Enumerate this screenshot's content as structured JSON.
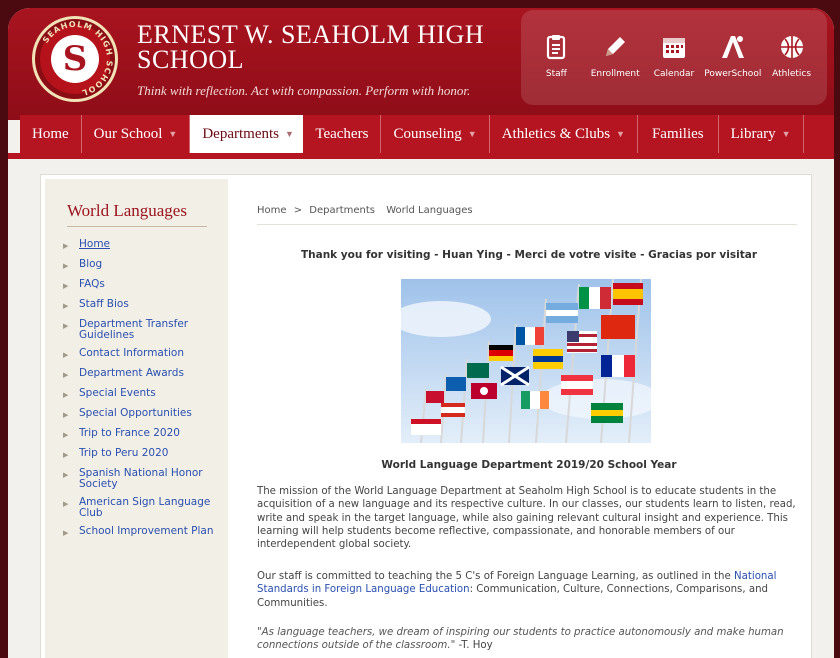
{
  "school": {
    "name": "ERNEST W. SEAHOLM HIGH SCHOOL",
    "motto": "Think with reflection. Act with compassion. Perform with honor.",
    "seal_text": "SEAHOLM HIGH SCHOOL",
    "seal_letter": "S"
  },
  "quicklinks": [
    {
      "label": "Staff",
      "icon": "clipboard-icon"
    },
    {
      "label": "Enrollment",
      "icon": "pencil-icon"
    },
    {
      "label": "Calendar",
      "icon": "calendar-icon"
    },
    {
      "label": "PowerSchool",
      "icon": "powerschool-icon"
    },
    {
      "label": "Athletics",
      "icon": "basketball-icon"
    }
  ],
  "nav": [
    {
      "label": "Home",
      "dropdown": false,
      "active": false
    },
    {
      "label": "Our School",
      "dropdown": true,
      "active": false
    },
    {
      "label": "Departments",
      "dropdown": true,
      "active": true
    },
    {
      "label": "Teachers",
      "dropdown": false,
      "active": false
    },
    {
      "label": "Counseling",
      "dropdown": true,
      "active": false
    },
    {
      "label": "Athletics & Clubs",
      "dropdown": true,
      "active": false
    },
    {
      "label": "Families",
      "dropdown": false,
      "active": false
    },
    {
      "label": "Library",
      "dropdown": true,
      "active": false
    }
  ],
  "sidebar": {
    "title": "World Languages",
    "items": [
      {
        "label": "Home"
      },
      {
        "label": "Blog"
      },
      {
        "label": "FAQs"
      },
      {
        "label": "Staff Bios"
      },
      {
        "label": "Department Transfer Guidelines"
      },
      {
        "label": "Contact Information"
      },
      {
        "label": "Department Awards"
      },
      {
        "label": "Special Events"
      },
      {
        "label": "Special Opportunities"
      },
      {
        "label": "Trip to France 2020"
      },
      {
        "label": "Trip to Peru 2020"
      },
      {
        "label": "Spanish National Honor Society"
      },
      {
        "label": "American Sign Language Club"
      },
      {
        "label": "School Improvement Plan"
      }
    ]
  },
  "breadcrumb": {
    "home": "Home",
    "sep": ">",
    "section": "Departments",
    "current": "World Languages"
  },
  "main": {
    "thanks": "Thank you for visiting - Huan Ying - Merci de votre visite - Gracias por visitar",
    "caption": "World Language Department 2019/20 School Year",
    "para1": "The mission of the World Language Department at Seaholm High School is to educate students in the acquisition of a new language and its respective culture. In our classes, our students learn to listen, read, write and speak in the target language, while also gaining relevant cultural insight and experience. This learning will help students become reflective, compassionate, and honorable members of our interdependent global society.",
    "para2_pre": "Our staff is committed to teaching the 5 C's of Foreign Language Learning, as outlined in the ",
    "para2_link": "National Standards in Foreign Language Education",
    "para2_post": ": Communication, Culture, Connections, Comparisons, and Communities.",
    "quote": "\"As language teachers, we dream of inspiring our students to practice autonomously and make human connections outside of the classroom.\"",
    "quote_author": " -T. Hoy"
  },
  "colors": {
    "brand_red": "#a8141f",
    "nav_red": "#b51521",
    "link_blue": "#2a4fb0"
  }
}
